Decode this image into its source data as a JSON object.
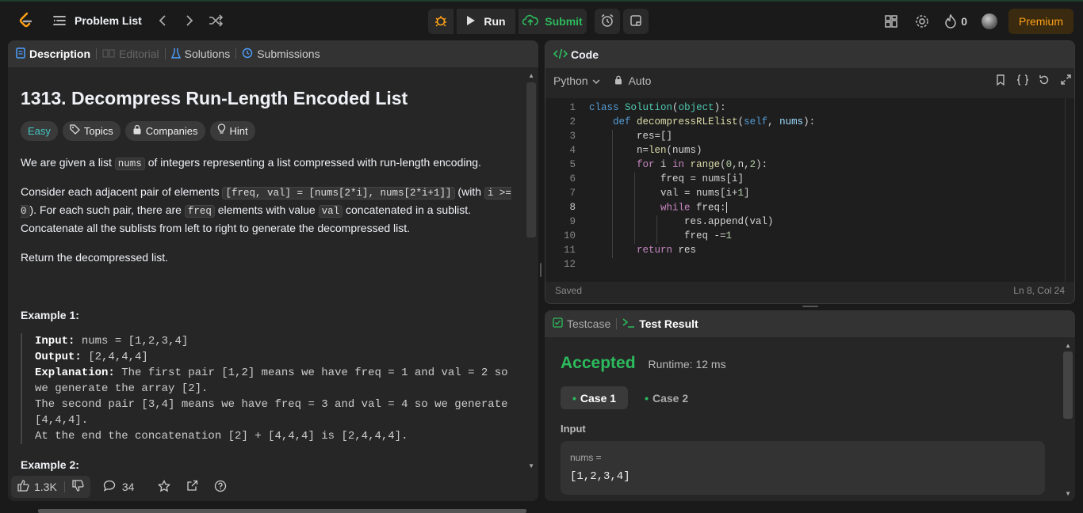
{
  "nav": {
    "problem_list": "Problem List",
    "run": "Run",
    "submit": "Submit",
    "streak_count": "0",
    "premium": "Premium"
  },
  "desc": {
    "tabs": [
      "Description",
      "Editorial",
      "Solutions",
      "Submissions"
    ],
    "title": "1313. Decompress Run-Length Encoded List",
    "difficulty": "Easy",
    "pills": [
      "Topics",
      "Companies",
      "Hint"
    ],
    "p1_pre": "We are given a list ",
    "p1_code": "nums",
    "p1_post": " of integers representing a list compressed with run-length encoding.",
    "p2_a": "Consider each adjacent pair of elements ",
    "p2_code1": "[freq, val] = [nums[2*i], nums[2*i+1]]",
    "p2_b": " (with ",
    "p2_code2": "i >= 0",
    "p2_c": ").  For each such pair, there are ",
    "p2_code3": "freq",
    "p2_d": " elements with value ",
    "p2_code4": "val",
    "p2_e": " concatenated in a sublist. Concatenate all the sublists from left to right to generate the decompressed list.",
    "p3": "Return the decompressed list.",
    "example1": "Example 1:",
    "ex_input_label": "Input:",
    "ex_input": " nums = [1,2,3,4]",
    "ex_output_label": "Output:",
    "ex_output": " [2,4,4,4]",
    "ex_expl_label": "Explanation:",
    "ex_expl": " The first pair [1,2] means we have freq = 1 and val = 2 so we generate the array [2].",
    "ex_line2": "The second pair [3,4] means we have freq = 3 and val = 4 so we generate [4,4,4].",
    "ex_line3": "At the end the concatenation [2] + [4,4,4] is [2,4,4,4].",
    "example2": "Example 2:",
    "likes": "1.3K",
    "comments": "34"
  },
  "code": {
    "header": "Code",
    "language": "Python",
    "auto": "Auto",
    "saved": "Saved",
    "position": "Ln 8, Col 24"
  },
  "result": {
    "tabs": [
      "Testcase",
      "Test Result"
    ],
    "status": "Accepted",
    "runtime": "Runtime: 12 ms",
    "cases": [
      "Case 1",
      "Case 2"
    ],
    "input_label": "Input",
    "var_label": "nums =",
    "var_value": "[1,2,3,4]"
  },
  "colors": {
    "accent_green": "#2cbb5d",
    "easy": "#46c6c2",
    "premium": "#ffa116",
    "link_blue": "#4c9fff"
  }
}
